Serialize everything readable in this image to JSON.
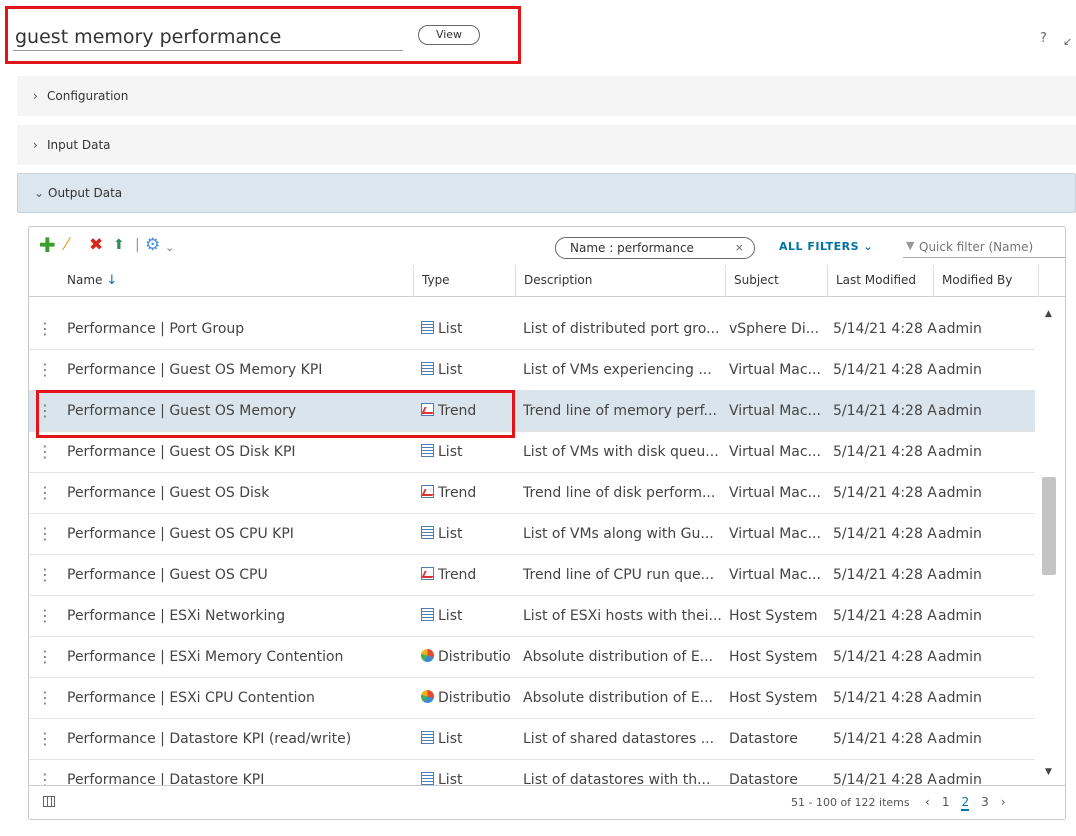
{
  "title": {
    "value": "guest memory performance",
    "view_label": "View"
  },
  "help_label": "?",
  "sections": {
    "configuration": "Configuration",
    "input_data": "Input Data",
    "output_data": "Output Data"
  },
  "toolbar": {
    "filter_chip": "Name : performance",
    "filter_chip_close": "×",
    "all_filters": "ALL FILTERS",
    "quick_filter_placeholder": "Quick filter (Name)"
  },
  "columns": {
    "name": "Name",
    "type": "Type",
    "description": "Description",
    "subject": "Subject",
    "last_modified": "Last Modified",
    "modified_by": "Modified By"
  },
  "rows": [
    {
      "name": "Performance | Port Group",
      "type": "List",
      "icon": "list-icon",
      "description": "List of distributed port gro...",
      "subject": "vSphere Di...",
      "modified": "5/14/21 4:28 A",
      "by": "admin"
    },
    {
      "name": "Performance | Guest OS Memory KPI",
      "type": "List",
      "icon": "list-icon",
      "description": "List of VMs experiencing ...",
      "subject": "Virtual Mac...",
      "modified": "5/14/21 4:28 A",
      "by": "admin"
    },
    {
      "name": "Performance | Guest OS Memory",
      "type": "Trend",
      "icon": "trend-icon",
      "description": "Trend line of memory perf...",
      "subject": "Virtual Mac...",
      "modified": "5/14/21 4:28 A",
      "by": "admin"
    },
    {
      "name": "Performance | Guest OS Disk KPI",
      "type": "List",
      "icon": "list-icon",
      "description": "List of VMs with disk queu...",
      "subject": "Virtual Mac...",
      "modified": "5/14/21 4:28 A",
      "by": "admin"
    },
    {
      "name": "Performance | Guest OS Disk",
      "type": "Trend",
      "icon": "trend-icon",
      "description": "Trend line of disk perform...",
      "subject": "Virtual Mac...",
      "modified": "5/14/21 4:28 A",
      "by": "admin"
    },
    {
      "name": "Performance | Guest OS CPU KPI",
      "type": "List",
      "icon": "list-icon",
      "description": "List of VMs along with Gu...",
      "subject": "Virtual Mac...",
      "modified": "5/14/21 4:28 A",
      "by": "admin"
    },
    {
      "name": "Performance | Guest OS CPU",
      "type": "Trend",
      "icon": "trend-icon",
      "description": "Trend line of CPU run que...",
      "subject": "Virtual Mac...",
      "modified": "5/14/21 4:28 A",
      "by": "admin"
    },
    {
      "name": "Performance | ESXi Networking",
      "type": "List",
      "icon": "list-icon",
      "description": "List of ESXi hosts with thei...",
      "subject": "Host System",
      "modified": "5/14/21 4:28 A",
      "by": "admin"
    },
    {
      "name": "Performance | ESXi Memory Contention",
      "type": "Distributio",
      "icon": "distribution-icon",
      "description": "Absolute distribution of E...",
      "subject": "Host System",
      "modified": "5/14/21 4:28 A",
      "by": "admin"
    },
    {
      "name": "Performance | ESXi CPU Contention",
      "type": "Distributio",
      "icon": "distribution-icon",
      "description": "Absolute distribution of E...",
      "subject": "Host System",
      "modified": "5/14/21 4:28 A",
      "by": "admin"
    },
    {
      "name": "Performance | Datastore KPI (read/write)",
      "type": "List",
      "icon": "list-icon",
      "description": "List of shared datastores ...",
      "subject": "Datastore",
      "modified": "5/14/21 4:28 A",
      "by": "admin"
    },
    {
      "name": "Performance | Datastore KPI",
      "type": "List",
      "icon": "list-icon",
      "description": "List of datastores with th...",
      "subject": "Datastore",
      "modified": "5/14/21 4:28 A",
      "by": "admin"
    }
  ],
  "selected_row": 2,
  "footer": {
    "items_count": "51 - 100 of 122 items",
    "prev": "‹",
    "pages": [
      "1",
      "2",
      "3"
    ],
    "current_page": "2",
    "next": "›"
  },
  "colors": {
    "highlight": "#e1141a",
    "selected_row": "#d9e4ec",
    "link": "#0072a3"
  }
}
